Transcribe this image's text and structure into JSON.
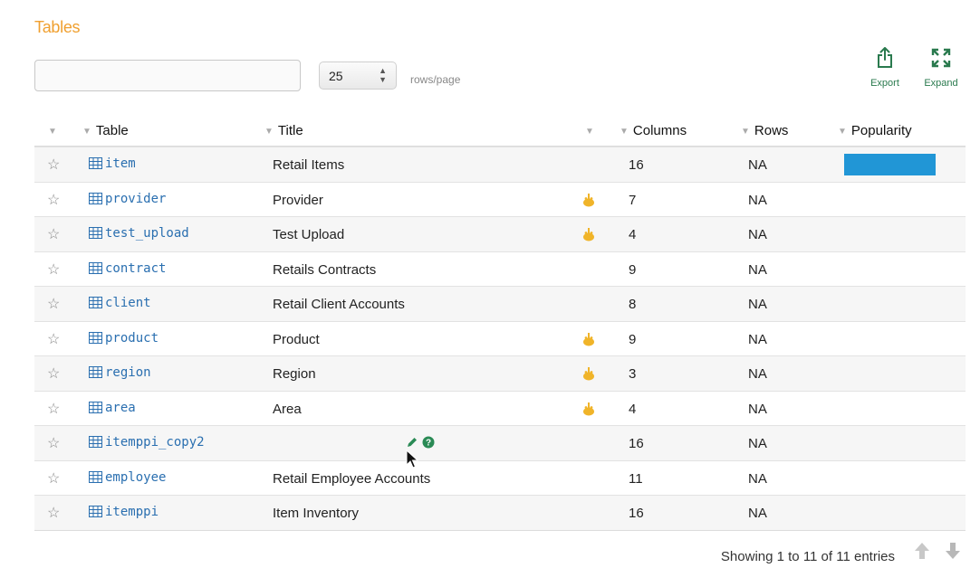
{
  "section": {
    "title": "Tables"
  },
  "search": {
    "value": "",
    "placeholder": ""
  },
  "pagination": {
    "page_size": "25",
    "rows_label": "rows/page"
  },
  "toolbar": {
    "export_label": "Export",
    "expand_label": "Expand",
    "export_icon": "export-icon",
    "expand_icon": "expand-icon"
  },
  "columns": {
    "table": "Table",
    "title": "Title",
    "columns": "Columns",
    "rows": "Rows",
    "popularity": "Popularity"
  },
  "rows": [
    {
      "name": "item",
      "title": "Retail Items",
      "flag": false,
      "columns": "16",
      "rows": "NA",
      "popular": true
    },
    {
      "name": "provider",
      "title": "Provider",
      "flag": true,
      "columns": "7",
      "rows": "NA",
      "popular": false
    },
    {
      "name": "test_upload",
      "title": "Test Upload",
      "flag": true,
      "columns": "4",
      "rows": "NA",
      "popular": false
    },
    {
      "name": "contract",
      "title": "Retails Contracts",
      "flag": false,
      "columns": "9",
      "rows": "NA",
      "popular": false
    },
    {
      "name": "client",
      "title": "Retail Client Accounts",
      "flag": false,
      "columns": "8",
      "rows": "NA",
      "popular": false
    },
    {
      "name": "product",
      "title": "Product",
      "flag": true,
      "columns": "9",
      "rows": "NA",
      "popular": false
    },
    {
      "name": "region",
      "title": "Region",
      "flag": true,
      "columns": "3",
      "rows": "NA",
      "popular": false
    },
    {
      "name": "area",
      "title": "Area",
      "flag": true,
      "columns": "4",
      "rows": "NA",
      "popular": false
    },
    {
      "name": "itemppi_copy2",
      "title": "",
      "flag": false,
      "columns": "16",
      "rows": "NA",
      "popular": false,
      "editing": true
    },
    {
      "name": "employee",
      "title": "Retail Employee Accounts",
      "flag": false,
      "columns": "11",
      "rows": "NA",
      "popular": false
    },
    {
      "name": "itemppi",
      "title": "Item Inventory",
      "flag": false,
      "columns": "16",
      "rows": "NA",
      "popular": false
    }
  ],
  "footer": {
    "info": "Showing 1 to 11 of 11 entries"
  },
  "colors": {
    "accent": "#f0a030",
    "link": "#2a6fb0",
    "popularity": "#2196d6",
    "tool": "#2a7a4e",
    "flag": "#f0b429"
  }
}
